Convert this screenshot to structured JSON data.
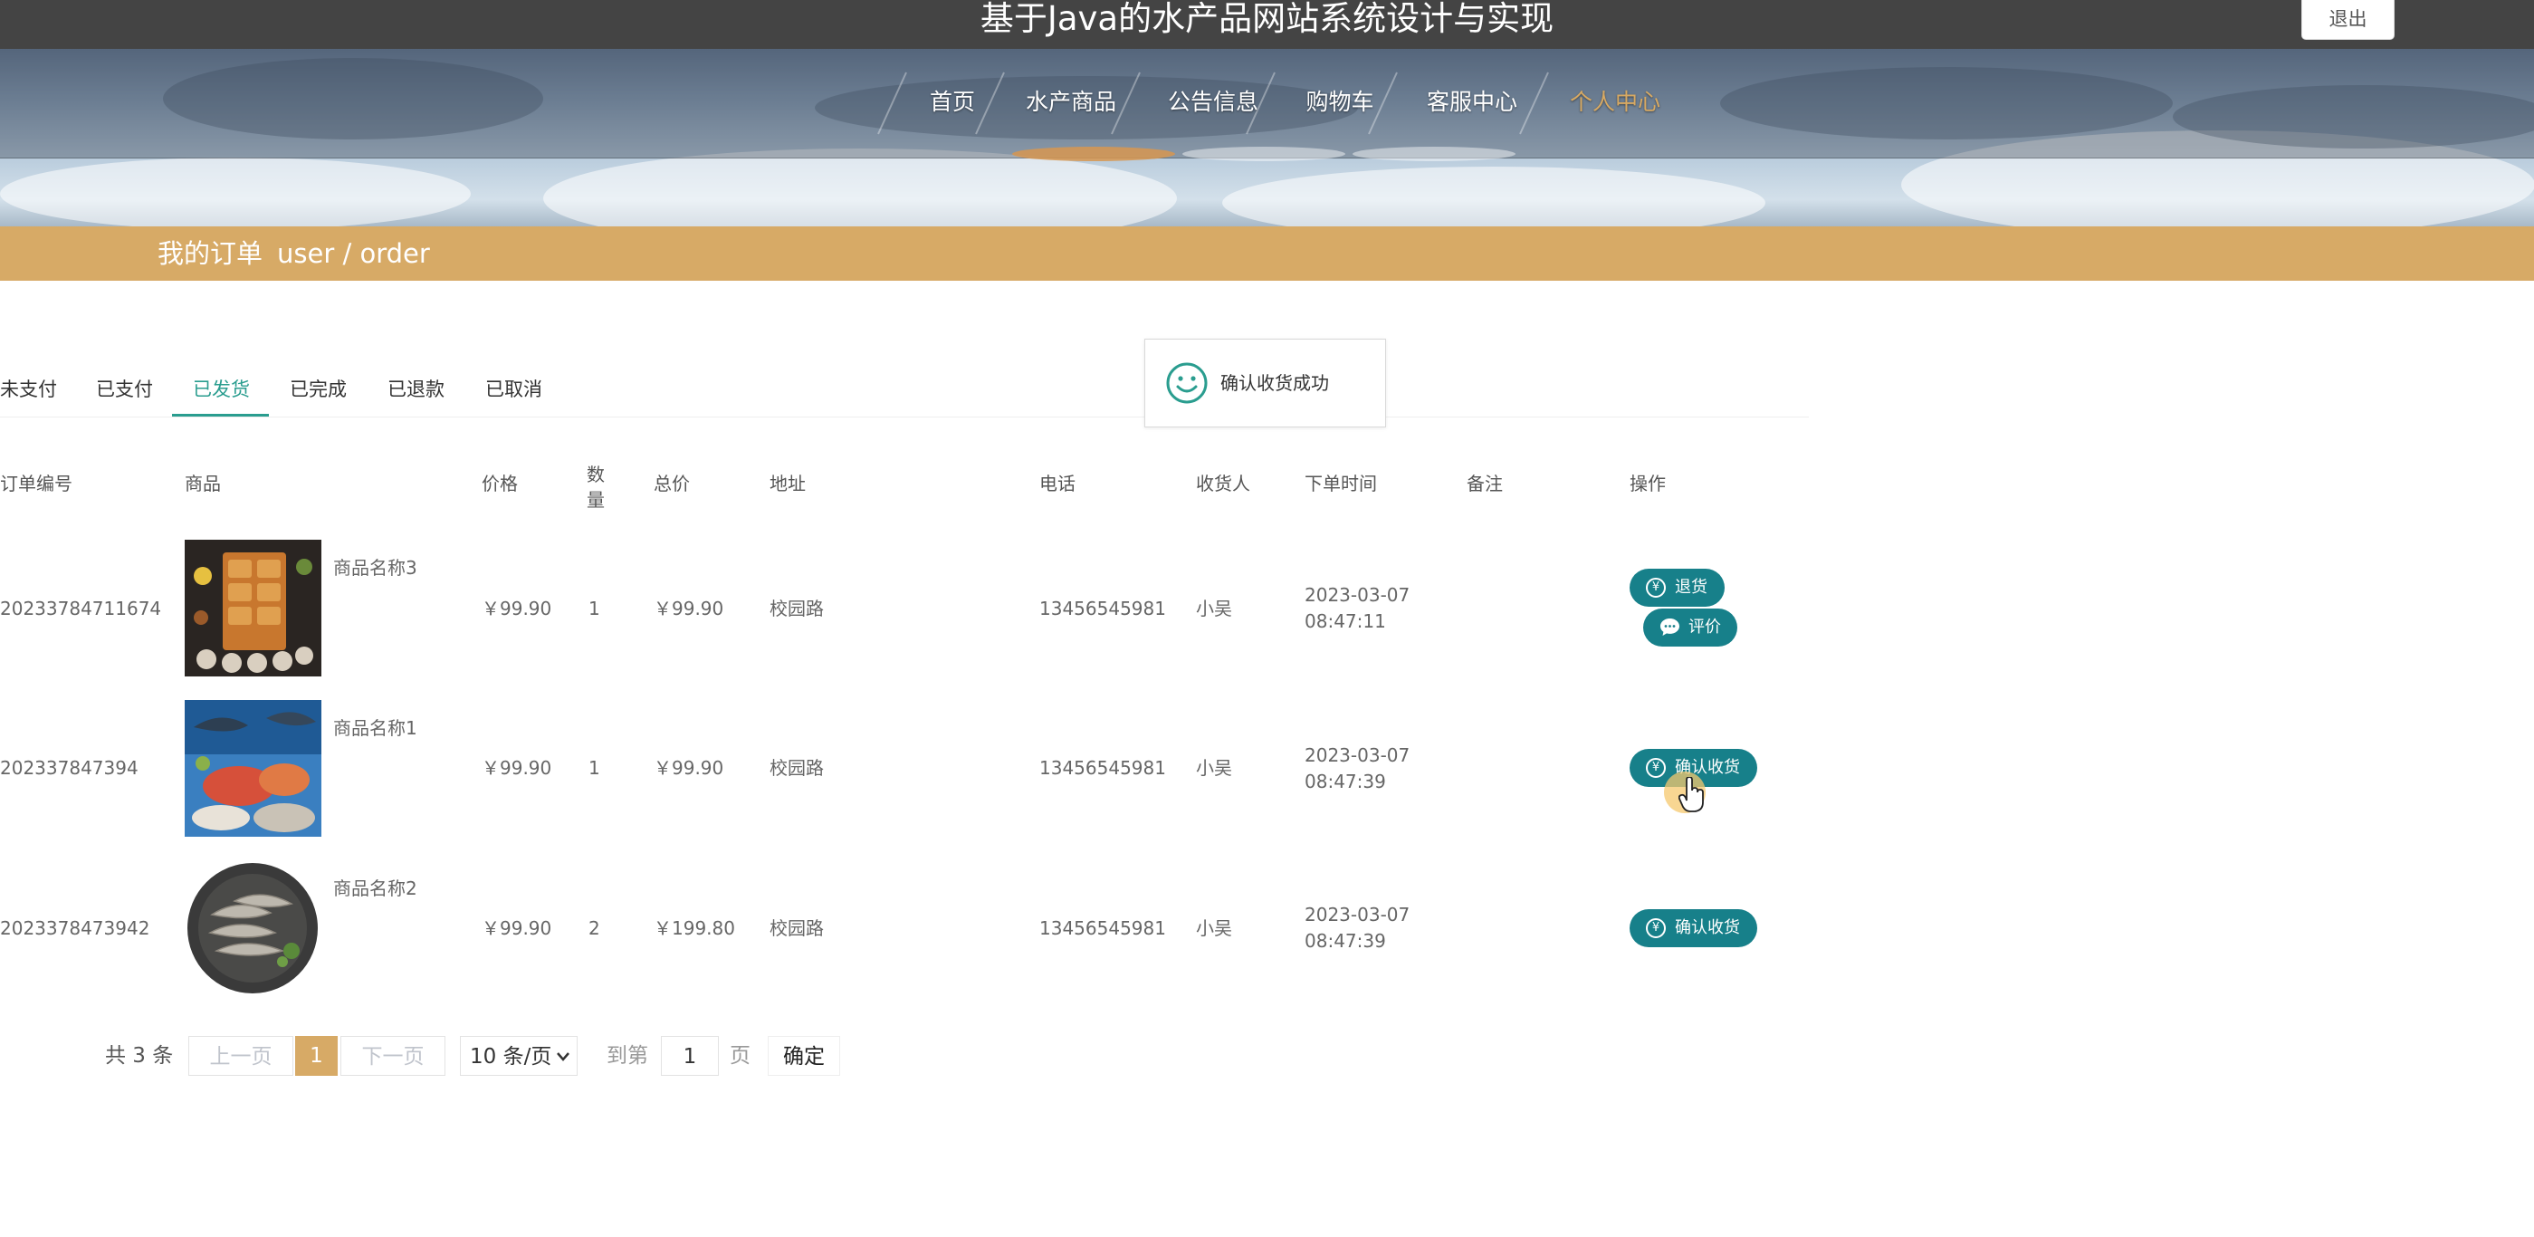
{
  "site": {
    "title": "基于Java的水产品网站系统设计与实现",
    "logout_label": "退出"
  },
  "nav": {
    "items": [
      {
        "label": "首页"
      },
      {
        "label": "水产商品"
      },
      {
        "label": "公告信息"
      },
      {
        "label": "购物车"
      },
      {
        "label": "客服中心"
      },
      {
        "label": "个人中心",
        "active": true
      }
    ]
  },
  "section": {
    "title_cn": "我的订单",
    "title_en": "user / order"
  },
  "tabs": [
    {
      "label": "未支付"
    },
    {
      "label": "已支付"
    },
    {
      "label": "已发货",
      "active": true
    },
    {
      "label": "已完成"
    },
    {
      "label": "已退款"
    },
    {
      "label": "已取消"
    }
  ],
  "toast": {
    "message": "确认收货成功"
  },
  "table": {
    "headers": {
      "order_no": "订单编号",
      "product": "商品",
      "price": "价格",
      "qty": "数量",
      "total": "总价",
      "address": "地址",
      "phone": "电话",
      "receiver": "收货人",
      "time": "下单时间",
      "remark": "备注",
      "action": "操作"
    },
    "rows": [
      {
        "order_no": "20233784711674",
        "product_name": "商品名称3",
        "image": "grilled-seafood-platter",
        "price": "￥99.90",
        "qty": "1",
        "total": "￥99.90",
        "address": "校园路",
        "phone": "13456545981",
        "receiver": "小吴",
        "date": "2023-03-07",
        "time": "08:47:11",
        "remark": "",
        "actions": [
          "退货",
          "评价"
        ]
      },
      {
        "order_no": "202337847394",
        "product_name": "商品名称1",
        "image": "seafood-display",
        "price": "￥99.90",
        "qty": "1",
        "total": "￥99.90",
        "address": "校园路",
        "phone": "13456545981",
        "receiver": "小吴",
        "date": "2023-03-07",
        "time": "08:47:39",
        "remark": "",
        "actions": [
          "确认收货"
        ]
      },
      {
        "order_no": "2023378473942",
        "product_name": "商品名称2",
        "image": "shrimp-plate",
        "price": "￥99.90",
        "qty": "2",
        "total": "￥199.80",
        "address": "校园路",
        "phone": "13456545981",
        "receiver": "小吴",
        "date": "2023-03-07",
        "time": "08:47:39",
        "remark": "",
        "actions": [
          "确认收货"
        ]
      }
    ]
  },
  "pagination": {
    "total": "共 3 条",
    "prev": "上一页",
    "current": "1",
    "next": "下一页",
    "page_size": "10 条/页",
    "goto_label": "到第",
    "goto_value": "1",
    "page_unit": "页",
    "confirm": "确定"
  },
  "colors": {
    "header_bg": "#444444",
    "accent_orange": "#d7aa66",
    "button_teal": "#17808a",
    "tab_active": "#2a9d8f"
  }
}
